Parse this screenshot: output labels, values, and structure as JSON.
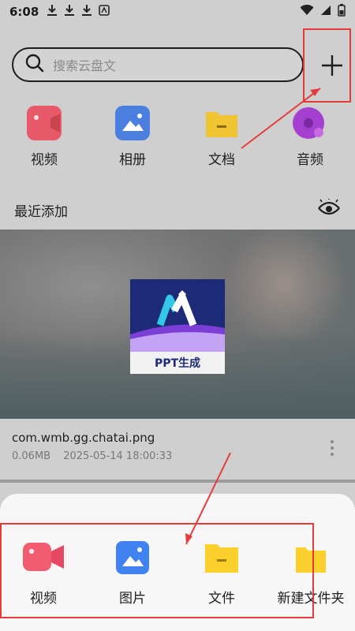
{
  "status_bar": {
    "time": "6:08",
    "notification_icons": [
      "download-icon",
      "download-icon",
      "download-icon",
      "app-notification-icon"
    ],
    "right_icons": [
      "wifi-icon",
      "signal-icon",
      "battery-icon"
    ]
  },
  "search": {
    "placeholder": "搜索云盘文",
    "icon": "search-icon"
  },
  "add_button": {
    "icon": "plus-icon"
  },
  "categories": [
    {
      "label": "视频",
      "icon": "video-icon",
      "color": "#e85a6a"
    },
    {
      "label": "相册",
      "icon": "album-icon",
      "color": "#4a7fe0"
    },
    {
      "label": "文档",
      "icon": "folder-document-icon",
      "color": "#f1c431"
    },
    {
      "label": "音频",
      "icon": "audio-icon",
      "color": "#a53fd0"
    }
  ],
  "recent": {
    "title": "最近添加",
    "toggle_icon": "eye-icon"
  },
  "recent_file": {
    "thumbnail_caption": "PPT生成",
    "name": "com.wmb.gg.chatai.png",
    "size": "0.06MB",
    "timestamp": "2025-05-14 18:00:33"
  },
  "upload_sheet": [
    {
      "label": "视频",
      "icon": "video-icon",
      "color": "#f25c70"
    },
    {
      "label": "图片",
      "icon": "image-icon",
      "color": "#3f82f0"
    },
    {
      "label": "文件",
      "icon": "file-folder-icon",
      "color": "#fbcf2c"
    },
    {
      "label": "新建文件夹",
      "icon": "new-folder-icon",
      "color": "#fbcf2c"
    }
  ],
  "accent_colors": {
    "annotation_red": "#e63b3b"
  }
}
